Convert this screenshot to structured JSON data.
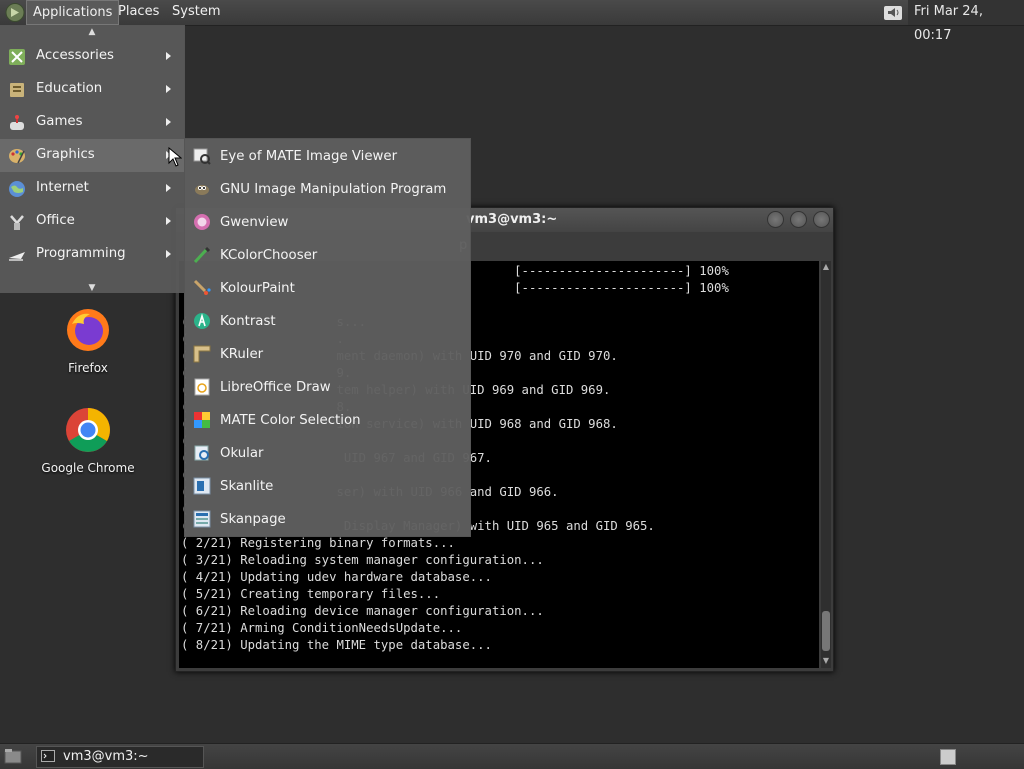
{
  "top_panel": {
    "applications": "Applications",
    "places": "Places",
    "system": "System",
    "clock": "Fri Mar 24, 00:17",
    "volume_icon": "speaker-icon"
  },
  "desktop": {
    "icons": [
      {
        "label": "Firefox",
        "icon": "firefox-icon"
      },
      {
        "label": "Google Chrome",
        "icon": "chrome-icon"
      }
    ]
  },
  "terminal": {
    "title": "vm3@vm3:~",
    "menubar_partial": "p",
    "lines": [
      "                                             [----------------------] 100%",
      "                                             [----------------------] 100%",
      "",
      "(                    s...",
      "(                    .",
      "(                    ment daemon) with UID 970 and GID 970.",
      "(                    9.",
      "(                    tem helper) with UID 969 and GID 969.",
      "(                    8.",
      "(                    ion service) with UID 968 and GID 968.",
      "(",
      "(                     UID 967 and GID 967.",
      "(",
      "(                    ser) with UID 966 and GID 966.",
      "(",
      "(                     Display Manager) with UID 965 and GID 965.",
      "( 2/21) Registering binary formats...",
      "( 3/21) Reloading system manager configuration...",
      "( 4/21) Updating udev hardware database...",
      "( 5/21) Creating temporary files...",
      "( 6/21) Reloading device manager configuration...",
      "( 7/21) Arming ConditionNeedsUpdate...",
      "( 8/21) Updating the MIME type database..."
    ]
  },
  "apps_menu": {
    "items": [
      {
        "label": "Accessories",
        "icon": "accessories-icon"
      },
      {
        "label": "Education",
        "icon": "education-icon"
      },
      {
        "label": "Games",
        "icon": "games-icon"
      },
      {
        "label": "Graphics",
        "icon": "graphics-icon"
      },
      {
        "label": "Internet",
        "icon": "internet-icon"
      },
      {
        "label": "Office",
        "icon": "office-icon"
      },
      {
        "label": "Programming",
        "icon": "programming-icon"
      }
    ],
    "active": "Graphics"
  },
  "graphics_submenu": {
    "items": [
      {
        "label": "Eye of MATE Image Viewer",
        "icon": "image-viewer-icon"
      },
      {
        "label": "GNU Image Manipulation Program",
        "icon": "gimp-icon"
      },
      {
        "label": "Gwenview",
        "icon": "gwenview-icon"
      },
      {
        "label": "KColorChooser",
        "icon": "color-picker-icon"
      },
      {
        "label": "KolourPaint",
        "icon": "paint-icon"
      },
      {
        "label": "Kontrast",
        "icon": "kontrast-icon"
      },
      {
        "label": "KRuler",
        "icon": "ruler-icon"
      },
      {
        "label": "LibreOffice Draw",
        "icon": "draw-icon"
      },
      {
        "label": "MATE Color Selection",
        "icon": "color-selection-icon"
      },
      {
        "label": "Okular",
        "icon": "okular-icon"
      },
      {
        "label": "Skanlite",
        "icon": "scanner-icon"
      },
      {
        "label": "Skanpage",
        "icon": "scan-page-icon"
      }
    ]
  },
  "bottom_panel": {
    "task_label": "vm3@vm3:~"
  }
}
